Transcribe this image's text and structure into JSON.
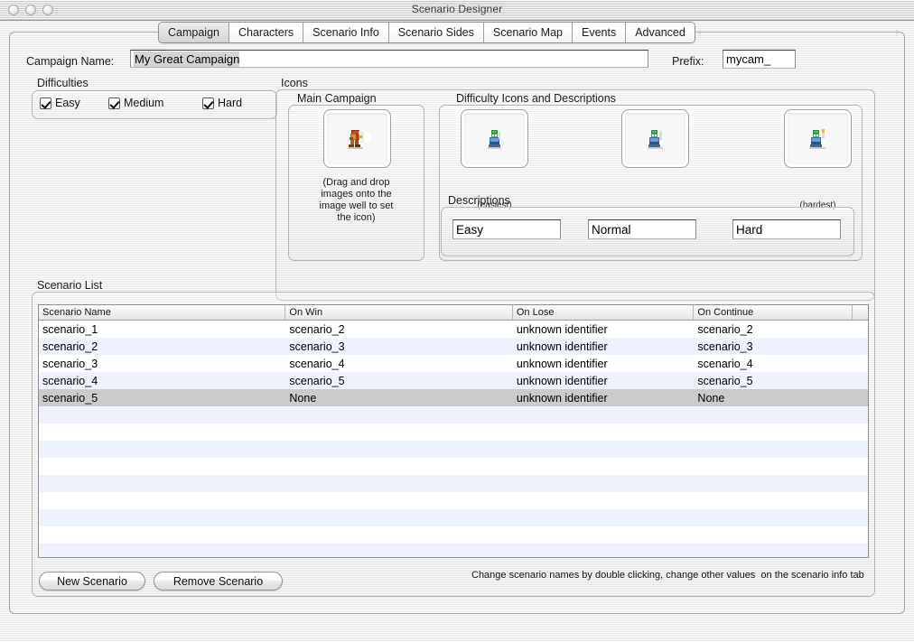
{
  "window": {
    "title": "Scenario Designer",
    "traffic_lights": [
      "close-button",
      "minimize-button",
      "zoom-button"
    ]
  },
  "tabs": [
    {
      "label": "Campaign",
      "selected": true
    },
    {
      "label": "Characters",
      "selected": false
    },
    {
      "label": "Scenario Info",
      "selected": false
    },
    {
      "label": "Scenario Sides",
      "selected": false
    },
    {
      "label": "Scenario Map",
      "selected": false
    },
    {
      "label": "Events",
      "selected": false
    },
    {
      "label": "Advanced",
      "selected": false
    }
  ],
  "campaign": {
    "name_label": "Campaign Name:",
    "name_value": "My Great Campaign",
    "prefix_label": "Prefix:",
    "prefix_value": "mycam_"
  },
  "difficulties": {
    "group_label": "Difficulties",
    "items": [
      {
        "label": "Easy",
        "checked": true
      },
      {
        "label": "Medium",
        "checked": true
      },
      {
        "label": "Hard",
        "checked": true
      }
    ]
  },
  "icons": {
    "group_label": "Icons",
    "main_campaign": {
      "label": "Main Campaign",
      "well_icon": "campaign-sprite-icon",
      "hint": "(Drag and drop\nimages onto the\nimage well to set\nthe icon)"
    },
    "difficulty_icons": {
      "label": "Difficulty Icons and Descriptions",
      "wells": [
        {
          "icon": "difficulty-sprite-easy-icon",
          "caption": "(easiest)"
        },
        {
          "icon": "difficulty-sprite-normal-icon",
          "caption": ""
        },
        {
          "icon": "difficulty-sprite-hard-icon",
          "caption": "(hardest)"
        }
      ],
      "descriptions_label": "Descriptions",
      "descriptions": [
        "Easy",
        "Normal",
        "Hard"
      ]
    }
  },
  "scenario_list": {
    "group_label": "Scenario List",
    "columns": [
      "Scenario Name",
      "On Win",
      "On Lose",
      "On Continue",
      ""
    ],
    "rows": [
      {
        "name": "scenario_1",
        "on_win": "scenario_2",
        "on_lose": "unknown identifier",
        "on_continue": "scenario_2",
        "extra": "",
        "selected": false
      },
      {
        "name": "scenario_2",
        "on_win": "scenario_3",
        "on_lose": "unknown identifier",
        "on_continue": "scenario_3",
        "extra": "",
        "selected": false
      },
      {
        "name": "scenario_3",
        "on_win": "scenario_4",
        "on_lose": "unknown identifier",
        "on_continue": "scenario_4",
        "extra": "",
        "selected": false
      },
      {
        "name": "scenario_4",
        "on_win": "scenario_5",
        "on_lose": "unknown identifier",
        "on_continue": "scenario_5",
        "extra": "",
        "selected": false
      },
      {
        "name": "scenario_5",
        "on_win": "None",
        "on_lose": "unknown identifier",
        "on_continue": "None",
        "extra": "",
        "selected": true
      },
      {
        "name": "",
        "on_win": "",
        "on_lose": "",
        "on_continue": "",
        "extra": "",
        "selected": false
      },
      {
        "name": "",
        "on_win": "",
        "on_lose": "",
        "on_continue": "",
        "extra": "",
        "selected": false
      },
      {
        "name": "",
        "on_win": "",
        "on_lose": "",
        "on_continue": "",
        "extra": "",
        "selected": false
      },
      {
        "name": "",
        "on_win": "",
        "on_lose": "",
        "on_continue": "",
        "extra": "",
        "selected": false
      },
      {
        "name": "",
        "on_win": "",
        "on_lose": "",
        "on_continue": "",
        "extra": "",
        "selected": false
      },
      {
        "name": "",
        "on_win": "",
        "on_lose": "",
        "on_continue": "",
        "extra": "",
        "selected": false
      },
      {
        "name": "",
        "on_win": "",
        "on_lose": "",
        "on_continue": "",
        "extra": "",
        "selected": false
      },
      {
        "name": "",
        "on_win": "",
        "on_lose": "",
        "on_continue": "",
        "extra": "",
        "selected": false
      },
      {
        "name": "",
        "on_win": "",
        "on_lose": "",
        "on_continue": "",
        "extra": "",
        "selected": false
      }
    ],
    "new_button": "New Scenario",
    "remove_button": "Remove Scenario",
    "hint": "Change scenario names by double clicking, change other values  on the scenario info tab"
  },
  "colors": {
    "window_bg": "#ededed",
    "row_alt": "#edf2fc",
    "row_selected": "#cbcbcb",
    "field_bg": "#ffffff",
    "text": "#000000"
  }
}
